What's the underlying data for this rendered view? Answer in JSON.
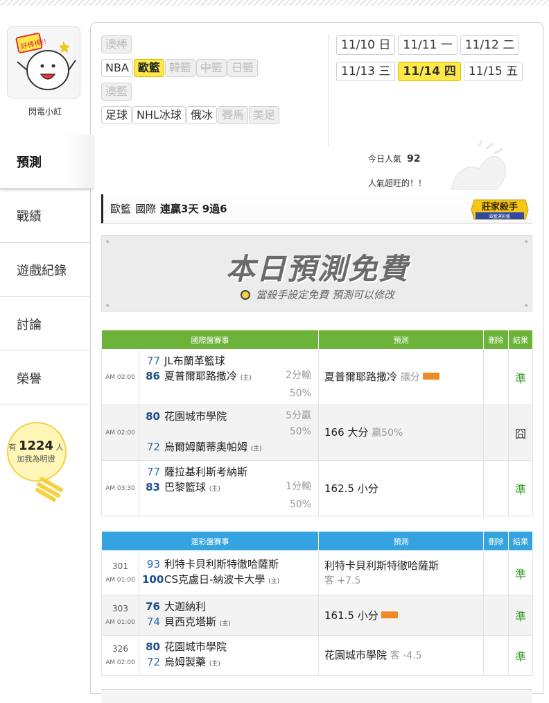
{
  "sidebar": {
    "user_name": "閃電小紅",
    "avatar_sticker_text": "好棒棒!!",
    "nav": [
      {
        "label": "預測",
        "active": true
      },
      {
        "label": "戰績",
        "active": false
      },
      {
        "label": "遊戲紀錄",
        "active": false
      },
      {
        "label": "討論",
        "active": false
      },
      {
        "label": "榮譽",
        "active": false
      }
    ],
    "likes_prefix": "有",
    "likes_count": "1224",
    "likes_suffix": "人",
    "likes_label": "加我為明燈"
  },
  "filters": {
    "row1": [
      {
        "label": "澳棒",
        "state": "off"
      }
    ],
    "row2": [
      {
        "label": "NBA",
        "state": "on"
      },
      {
        "label": "歐籃",
        "state": "sel"
      },
      {
        "label": "韓籃",
        "state": "off"
      },
      {
        "label": "中籃",
        "state": "off"
      },
      {
        "label": "日籃",
        "state": "off"
      }
    ],
    "row3": [
      {
        "label": "澳籃",
        "state": "off"
      }
    ],
    "row4": [
      {
        "label": "足球",
        "state": "on"
      },
      {
        "label": "NHL冰球",
        "state": "on"
      },
      {
        "label": "俄冰",
        "state": "on"
      },
      {
        "label": "賽馬",
        "state": "off"
      },
      {
        "label": "美足",
        "state": "off"
      }
    ]
  },
  "dates": [
    {
      "md": "11/10",
      "dow": "日",
      "sel": false
    },
    {
      "md": "11/11",
      "dow": "一",
      "sel": false
    },
    {
      "md": "11/12",
      "dow": "二",
      "sel": false
    },
    {
      "md": "11/13",
      "dow": "三",
      "sel": false
    },
    {
      "md": "11/14",
      "dow": "四",
      "sel": true
    },
    {
      "md": "11/15",
      "dow": "五",
      "sel": false
    }
  ],
  "popularity": {
    "label": "今日人氣",
    "value": "92",
    "note": "人氣超旺的！！"
  },
  "streak": {
    "league": "歐籃",
    "category": "國際",
    "record": "連贏3天 9過6"
  },
  "badge": {
    "title": "莊家殺手",
    "subtitle": "歐籃運彩盤"
  },
  "free_banner": {
    "title": "本日預測免費",
    "subtitle": "當殺手設定免費 預測可以修改"
  },
  "intl_table": {
    "headers": [
      "國際盤賽事",
      "預測",
      "刪除",
      "結果"
    ],
    "rows": [
      {
        "time": "AM 02:00",
        "t1_score": "77",
        "t1": "JL布蘭革籃球",
        "t1_home": "",
        "t2_score": "86",
        "t2": "夏普爾耶路撒冷",
        "t2_home": "(主)",
        "line": "2分輸",
        "line_pct": "50%",
        "pred_main": "夏普爾耶路撒冷",
        "pred_sub": "讓分",
        "pred_tag": true,
        "result": "準",
        "alt": false
      },
      {
        "time": "AM 02:00",
        "t1_score": "80",
        "t1": "花園城市學院",
        "t1_home": "",
        "t2_score": "72",
        "t2": "烏爾姆蘭蒂奧帕姆",
        "t2_home": "(主)",
        "line": "5分贏",
        "line_pct": "50%",
        "pred_main": "166 大分",
        "pred_sub": "贏50%",
        "pred_tag": false,
        "result": "囧",
        "alt": true
      },
      {
        "time": "AM 03:30",
        "t1_score": "77",
        "t1": "薩拉基利斯考納斯",
        "t1_home": "",
        "t2_score": "83",
        "t2": "巴黎籃球",
        "t2_home": "(主)",
        "line": "1分輸",
        "line_pct": "50%",
        "pred_main": "162.5 小分",
        "pred_sub": "",
        "pred_tag": false,
        "result": "準",
        "alt": false
      }
    ]
  },
  "lottery_table": {
    "headers": [
      "運彩盤賽事",
      "預測",
      "刪除",
      "結果"
    ],
    "rows": [
      {
        "no": "301",
        "time": "AM 01:00",
        "t1_score": "93",
        "t1": "利特卡貝利斯特徹哈薩斯",
        "t2_score": "100",
        "t2": "CS克盧日-納波卡大學",
        "t2_home": "(主)",
        "pred_main": "利特卡貝利斯特徹哈薩斯",
        "pred_sub": "客 +7.5",
        "pred_tag": false,
        "result": "準",
        "alt": false
      },
      {
        "no": "303",
        "time": "AM 01:00",
        "t1_score": "76",
        "t1": "大迦納利",
        "t2_score": "74",
        "t2": "貝西克塔斯",
        "t2_home": "(主)",
        "pred_main": "161.5 小分",
        "pred_sub": "",
        "pred_tag": true,
        "result": "準",
        "alt": true
      },
      {
        "no": "326",
        "time": "AM 02:00",
        "t1_score": "80",
        "t1": "花園城市學院",
        "t2_score": "72",
        "t2": "烏姆製藥",
        "t2_home": "(主)",
        "pred_main": "花園城市學院",
        "pred_sub": "客 -4.5",
        "pred_tag": false,
        "result": "準",
        "alt": false
      }
    ]
  }
}
